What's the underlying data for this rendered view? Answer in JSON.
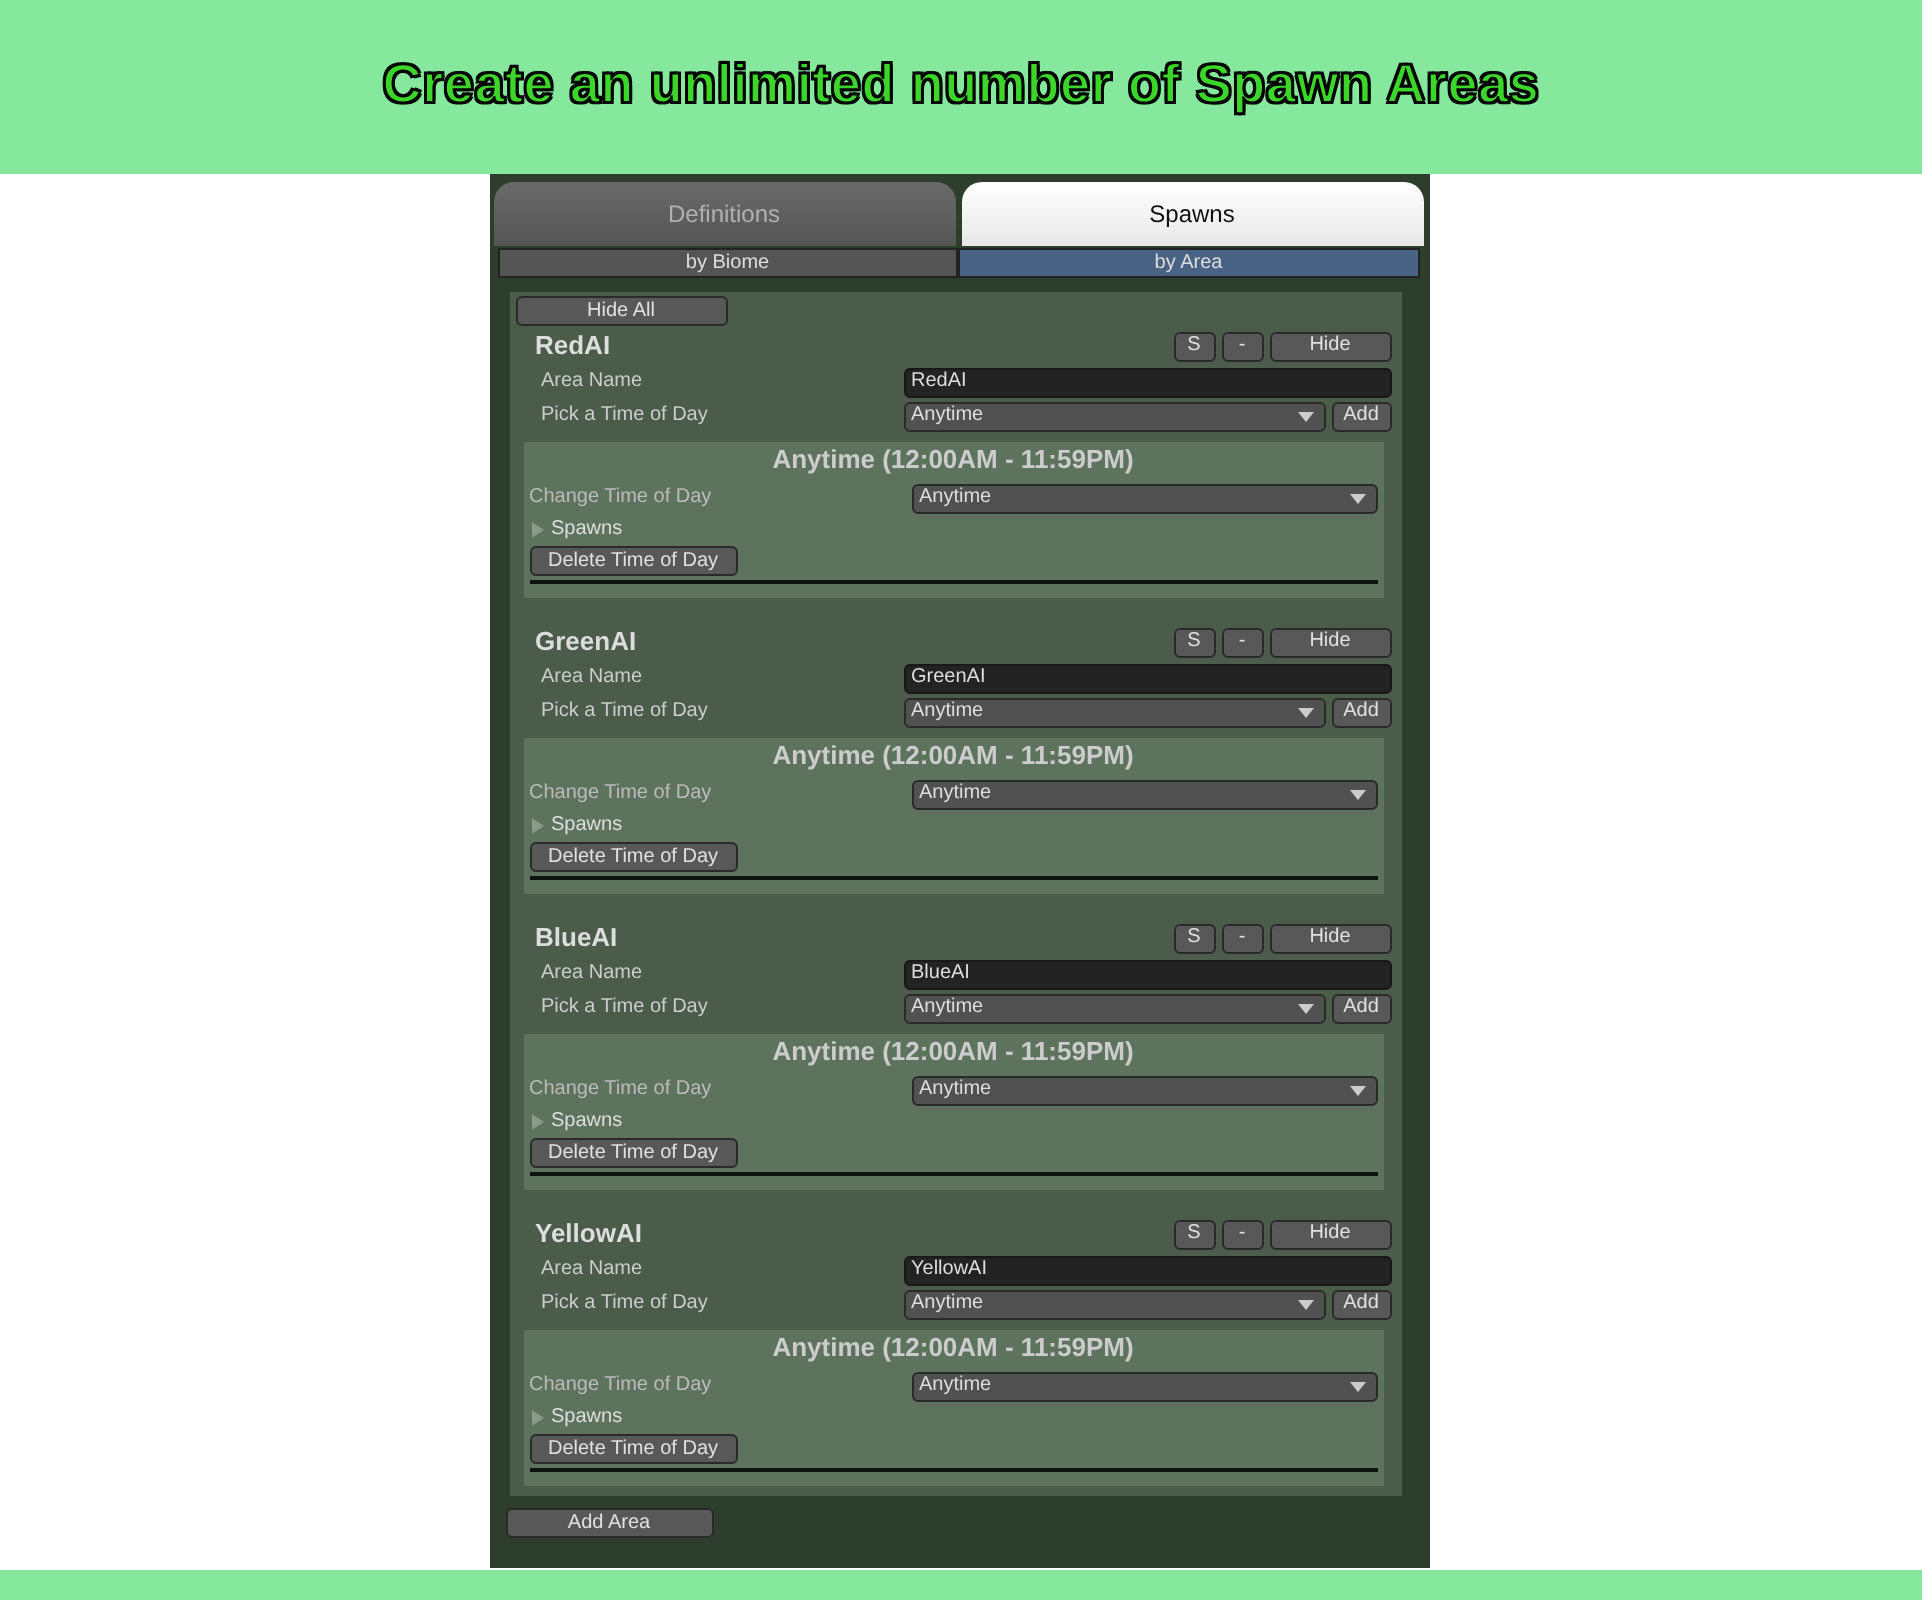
{
  "banner": {
    "title": "Create an unlimited number of Spawn Areas"
  },
  "tabs": [
    {
      "label": "Definitions",
      "selected": false
    },
    {
      "label": "Spawns",
      "selected": true
    }
  ],
  "subtabs": [
    {
      "label": "by Biome",
      "selected": false
    },
    {
      "label": "by Area",
      "selected": true
    }
  ],
  "hide_all_button": "Hide All",
  "areas": [
    {
      "name": "RedAI",
      "buttons": [
        "S",
        "-",
        "Hide"
      ],
      "area_name_label": "Area Name",
      "area_name_value": "RedAI",
      "pick_label": "Pick a Time of Day",
      "pick_value": "Anytime",
      "add_button": "Add",
      "times": [
        {
          "title": "Anytime (12:00AM - 11:59PM)",
          "change_label": "Change Time of Day",
          "change_value": "Anytime",
          "spawns_label": "Spawns",
          "expanded": false,
          "delete_button": "Delete Time of Day"
        }
      ]
    },
    {
      "name": "GreenAI",
      "buttons": [
        "S",
        "-",
        "Hide"
      ],
      "area_name_label": "Area Name",
      "area_name_value": "GreenAI",
      "pick_label": "Pick a Time of Day",
      "pick_value": "Anytime",
      "add_button": "Add",
      "times": [
        {
          "title": "Anytime (12:00AM - 11:59PM)",
          "change_label": "Change Time of Day",
          "change_value": "Anytime",
          "spawns_label": "Spawns",
          "expanded": false,
          "delete_button": "Delete Time of Day"
        }
      ]
    },
    {
      "name": "BlueAI",
      "buttons": [
        "S",
        "-",
        "Hide"
      ],
      "area_name_label": "Area Name",
      "area_name_value": "BlueAI",
      "pick_label": "Pick a Time of Day",
      "pick_value": "Anytime",
      "add_button": "Add",
      "times": [
        {
          "title": "Anytime (12:00AM - 11:59PM)",
          "change_label": "Change Time of Day",
          "change_value": "Anytime",
          "spawns_label": "Spawns",
          "expanded": false,
          "delete_button": "Delete Time of Day"
        }
      ]
    },
    {
      "name": "YellowAI",
      "buttons": [
        "S",
        "-",
        "Hide"
      ],
      "area_name_label": "Area Name",
      "area_name_value": "YellowAI",
      "pick_label": "Pick a Time of Day",
      "pick_value": "Anytime",
      "add_button": "Add",
      "times": [
        {
          "title": "Anytime (12:00AM - 11:59PM)",
          "change_label": "Change Time of Day",
          "change_value": "Anytime",
          "spawns_label": "Spawns",
          "expanded": false,
          "delete_button": "Delete Time of Day"
        }
      ]
    }
  ],
  "add_area_button": "Add Area"
}
